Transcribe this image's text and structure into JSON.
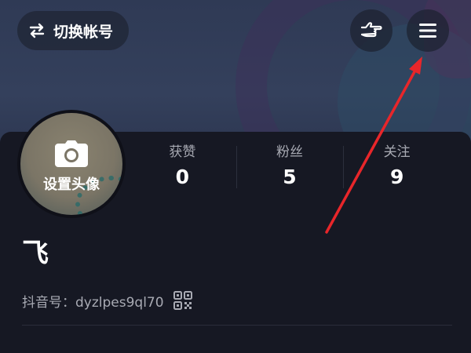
{
  "topbar": {
    "switch_account_label": "切换帐号",
    "switch_icon": "swap-arrows-icon",
    "hand_icon": "pointing-hand-icon",
    "menu_icon": "hamburger-menu-icon"
  },
  "avatar": {
    "label": "设置头像",
    "icon": "camera-icon"
  },
  "stats": [
    {
      "label": "获赞",
      "value": "0"
    },
    {
      "label": "粉丝",
      "value": "5"
    },
    {
      "label": "关注",
      "value": "9"
    }
  ],
  "profile": {
    "nickname": "飞",
    "douyin_id": "抖音号：dyzlpes9ql70",
    "qr_icon": "qr-code-icon",
    "bio": ""
  },
  "annotation": {
    "color": "#e8262a"
  }
}
